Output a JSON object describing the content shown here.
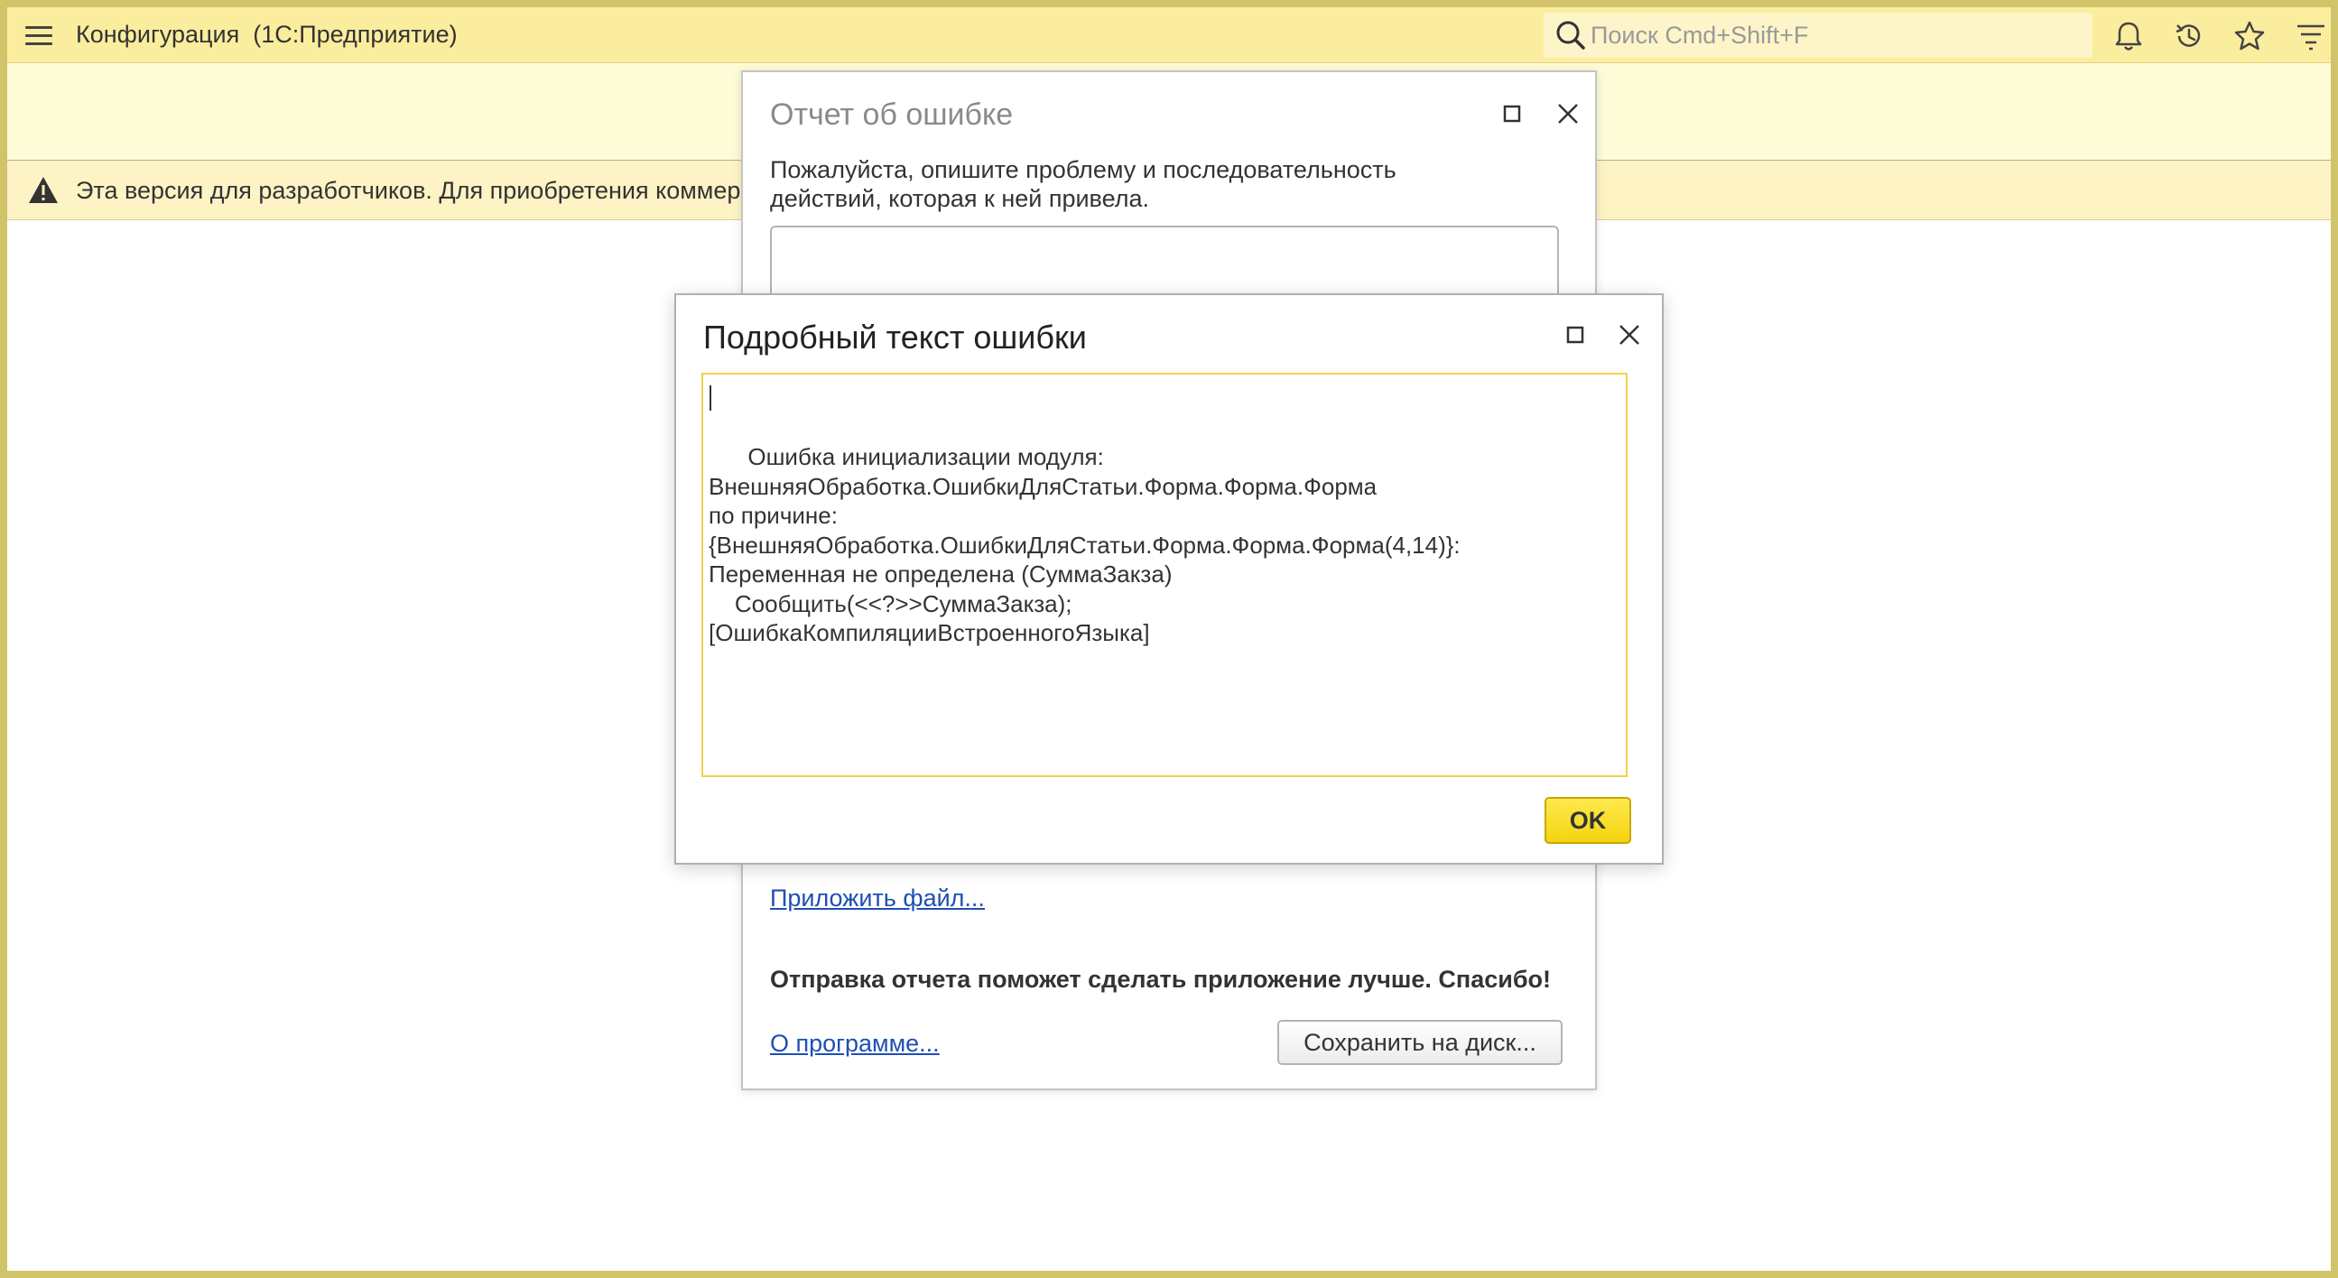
{
  "app": {
    "title": "Конфигурация  (1С:Предприятие)",
    "search_placeholder": "Поиск Cmd+Shift+F"
  },
  "toolbar_icons": [
    "bell-icon",
    "history-icon",
    "star-icon",
    "funnel-menu-icon"
  ],
  "dev_banner": {
    "text": "Эта версия для разработчиков. Для приобретения коммер"
  },
  "report_dialog": {
    "title": "Отчет об ошибке",
    "description": "Пожалуйста, опишите проблему и последовательность действий, которая к ней привела.",
    "attach_link": "Приложить файл...",
    "thanks_text": "Отправка отчета поможет сделать приложение лучше. Спасибо!",
    "about_link": "О программе...",
    "save_button": "Сохранить на диск..."
  },
  "details_dialog": {
    "title": "Подробный текст ошибки",
    "error_text": "Ошибка инициализации модуля:\nВнешняяОбработка.ОшибкиДляСтатьи.Форма.Форма.Форма\nпо причине:\n{ВнешняяОбработка.ОшибкиДляСтатьи.Форма.Форма.Форма(4,14)}:\nПеременная не определена (СуммаЗакза)\n    Сообщить(<<?>>СуммаЗакза);\n[ОшибкаКомпиляцииВстроенногоЯзыка]",
    "ok_button": "OK"
  },
  "colors": {
    "titlebar": "#fbed9e",
    "frame": "#d1c36a",
    "accent_yellow": "#f4d40f",
    "link": "#1f4fb3"
  }
}
